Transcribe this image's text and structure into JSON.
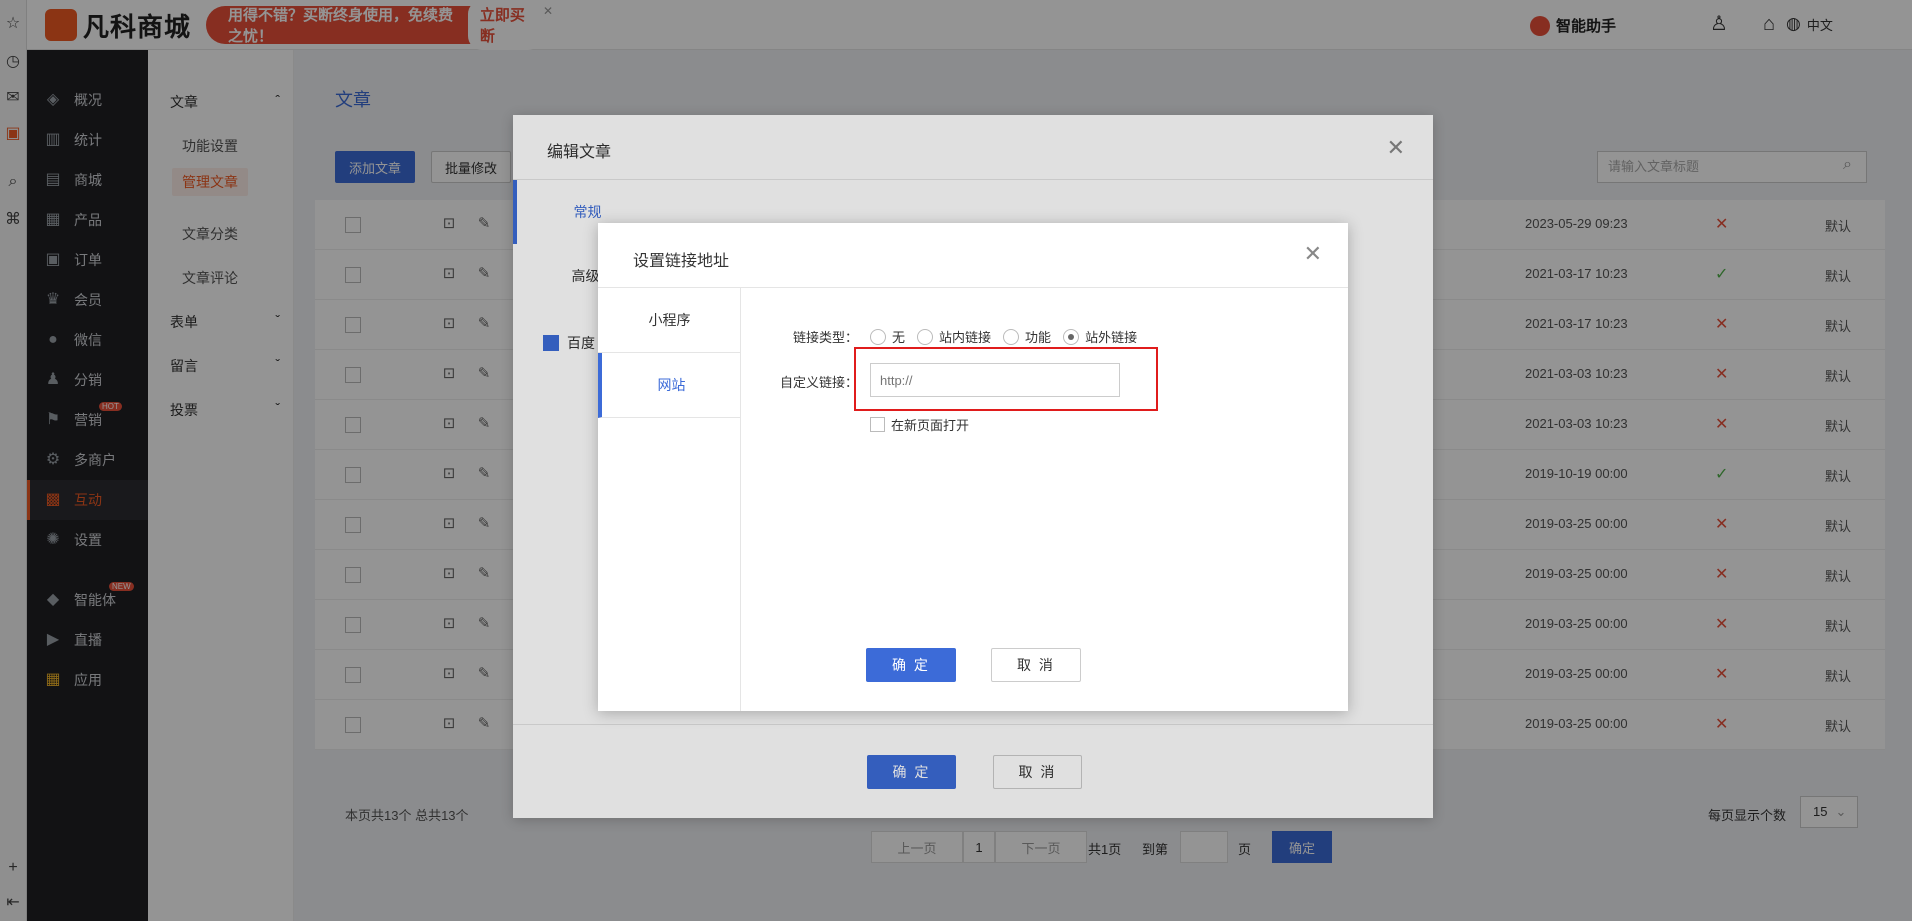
{
  "topbar": {
    "logo_text": "凡科商城",
    "promo_text": "用得不错？买断终身使用，免续费之忧！",
    "promo_button": "立即买断",
    "assistant_label": "智能助手",
    "language": "中文"
  },
  "sidebar": {
    "items": [
      {
        "label": "概况"
      },
      {
        "label": "统计"
      },
      {
        "label": "商城"
      },
      {
        "label": "产品"
      },
      {
        "label": "订单"
      },
      {
        "label": "会员"
      },
      {
        "label": "微信"
      },
      {
        "label": "分销"
      },
      {
        "label": "营销",
        "badge": "HOT"
      },
      {
        "label": "多商户"
      },
      {
        "label": "互动"
      },
      {
        "label": "设置"
      },
      {
        "label": "智能体",
        "badge": "NEW"
      },
      {
        "label": "直播"
      },
      {
        "label": "应用"
      }
    ]
  },
  "submenu": {
    "group_article": "文章",
    "item_function": "功能设置",
    "item_manage": "管理文章",
    "item_category": "文章分类",
    "item_comment": "文章评论",
    "group_form": "表单",
    "group_message": "留言",
    "group_vote": "投票"
  },
  "main": {
    "breadcrumb": "文章",
    "add_button": "添加文章",
    "batch_button": "批量修改",
    "search_placeholder": "请输入文章标题",
    "rows": [
      {
        "date": "2023-05-29 09:23",
        "ok": false,
        "status": "默认"
      },
      {
        "date": "2021-03-17 10:23",
        "ok": true,
        "status": "默认"
      },
      {
        "date": "2021-03-17 10:23",
        "ok": false,
        "status": "默认"
      },
      {
        "date": "2021-03-03 10:23",
        "ok": false,
        "status": "默认"
      },
      {
        "date": "2021-03-03 10:23",
        "ok": false,
        "status": "默认"
      },
      {
        "date": "2019-10-19 00:00",
        "ok": true,
        "status": "默认"
      },
      {
        "date": "2019-03-25 00:00",
        "ok": false,
        "status": "默认"
      },
      {
        "date": "2019-03-25 00:00",
        "ok": false,
        "status": "默认"
      },
      {
        "date": "2019-03-25 00:00",
        "ok": false,
        "status": "默认"
      },
      {
        "date": "2019-03-25 00:00",
        "ok": false,
        "status": "默认"
      },
      {
        "date": "2019-03-25 00:00",
        "ok": false,
        "status": "默认"
      }
    ],
    "footer_count": "本页共13个  总共13个",
    "pager": {
      "prev": "上一页",
      "page": "1",
      "next": "下一页",
      "total": "共1页",
      "goto": "到第",
      "page_unit": "页",
      "go": "确定"
    },
    "per_page_label": "每页显示个数",
    "per_page_value": "15"
  },
  "edit_dialog": {
    "title": "编辑文章",
    "tab_general": "常规",
    "tab_advanced": "高级",
    "baidu_label": "百度",
    "confirm": "确 定",
    "cancel": "取 消"
  },
  "link_dialog": {
    "title": "设置链接地址",
    "tab_mini": "小程序",
    "tab_site": "网站",
    "link_type_label": "链接类型：",
    "options": [
      "无",
      "站内链接",
      "功能",
      "站外链接"
    ],
    "custom_label": "自定义链接：",
    "url_placeholder": "http://",
    "new_page_label": "在新页面打开",
    "confirm": "确 定",
    "cancel": "取 消"
  },
  "colors": {
    "accent": "#3c6bd8",
    "brand": "#f05a23",
    "highlight": "#e01c1c"
  }
}
